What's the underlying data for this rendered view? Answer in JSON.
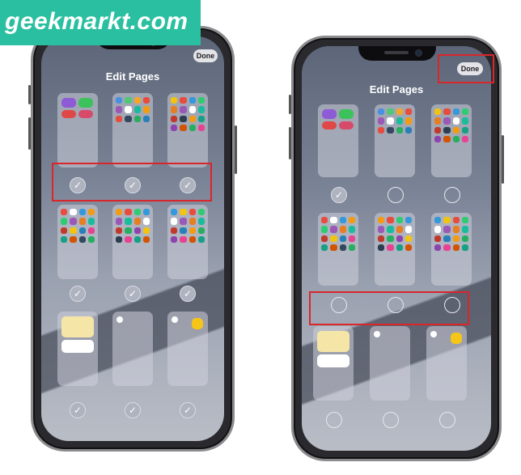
{
  "brand": {
    "logo_text": "geekmarkt.com",
    "logo_color": "#29bfa0"
  },
  "left_phone": {
    "title": "Edit Pages",
    "done_label": "Done",
    "pages": [
      {
        "state": "checked"
      },
      {
        "state": "checked"
      },
      {
        "state": "checked"
      },
      {
        "state": "checked"
      },
      {
        "state": "checked"
      },
      {
        "state": "checked"
      },
      {
        "state": "checked"
      },
      {
        "state": "checked"
      },
      {
        "state": "checked"
      }
    ]
  },
  "right_phone": {
    "title": "Edit Pages",
    "done_label": "Done",
    "pages": [
      {
        "state": "checked"
      },
      {
        "state": "unchecked"
      },
      {
        "state": "unchecked"
      },
      {
        "state": "unchecked"
      },
      {
        "state": "unchecked"
      },
      {
        "state": "unchecked"
      },
      {
        "state": "unchecked"
      },
      {
        "state": "unchecked"
      },
      {
        "state": "unchecked"
      }
    ]
  },
  "highlight_color": "#d8262a",
  "check_symbol": "✓"
}
